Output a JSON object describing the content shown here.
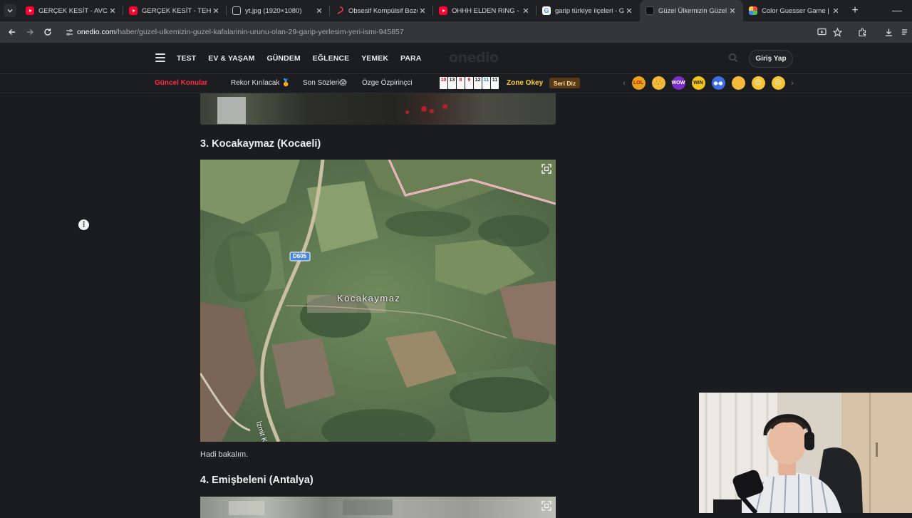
{
  "browser": {
    "tabs": [
      {
        "title": "GERÇEK KESİT - AVCI - You",
        "icon": "youtube-icon",
        "active": false
      },
      {
        "title": "GERÇEK KESİT - TEHLİKELİ",
        "icon": "youtube-icon",
        "active": false
      },
      {
        "title": "yt.jpg (1920×1080)",
        "icon": "globe-icon",
        "active": false
      },
      {
        "title": "Obsesif Kompülsif Bozukl",
        "icon": "obs-icon",
        "active": false
      },
      {
        "title": "OHHH ELDEN RING - You",
        "icon": "youtube-icon",
        "active": false
      },
      {
        "title": "garip türkiye ilçeleri - Goo",
        "icon": "google-icon",
        "active": false
      },
      {
        "title": "Güzel Ülkemizin Güzel Ka",
        "icon": "onedio-icon",
        "active": true
      },
      {
        "title": "Color Guesser Game | Gu",
        "icon": "color-guesser-icon",
        "active": false
      }
    ],
    "close_glyph": "✕",
    "new_tab_glyph": "+",
    "minimize_glyph": "—",
    "url_host": "onedio.com",
    "url_path": "/haber/guzel-ulkemizin-guzel-kafalarinin-urunu-olan-29-garip-yerlesim-yeri-ismi-945857"
  },
  "header": {
    "nav": [
      "TEST",
      "EV & YAŞAM",
      "GÜNDEM",
      "EĞLENCE",
      "YEMEK",
      "PARA"
    ],
    "logo": "onedio",
    "login": "Giriş Yap"
  },
  "subnav": {
    "hot_label": "Güncel Konular",
    "items": [
      "Rekor Kırılacak 🏅",
      "Son Sözleri😱",
      "Özge Özpirinçci"
    ],
    "tiles": [
      "10",
      "13",
      "8",
      "9",
      "12",
      "11",
      "11"
    ],
    "zone_okey": "Zone Okey",
    "seri_diz": "Seri Diz"
  },
  "article": {
    "section3_title": "3. Kocakaymaz (Kocaeli)",
    "map_place_label": "Kocakaymaz",
    "map_road_label": "D605",
    "map_road_name": "İzmit K",
    "caption": "Hadi bakalım.",
    "section4_title": "4. Emişbeleni (Antalya)"
  },
  "colors": {
    "page_bg": "#1a1c1f",
    "hot_topic": "#ff2a3d",
    "zone_okey": "#ffcf2b",
    "map_road_badge": "#4a84d9"
  }
}
